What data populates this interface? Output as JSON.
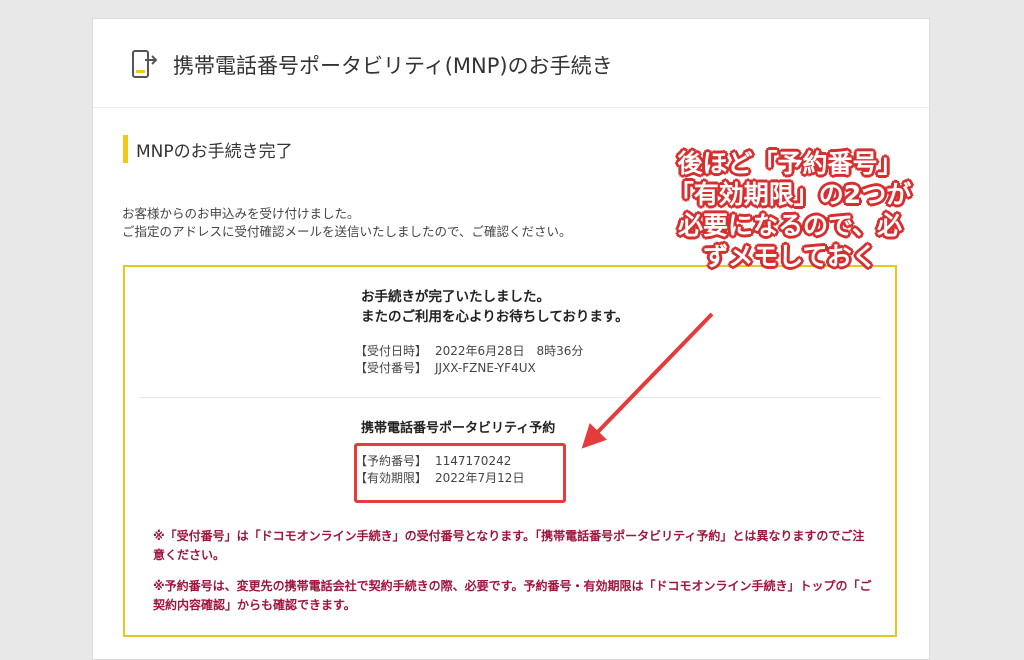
{
  "header": {
    "title": "携帯電話番号ポータビリティ(MNP)のお手続き",
    "icon": "phone-transfer-icon"
  },
  "section": {
    "title": "MNPのお手続き完了"
  },
  "intro": {
    "line1": "お客様からのお申込みを受け付けました。",
    "line2": "ご指定のアドレスに受付確認メールを送信いたしましたので、ご確認ください。"
  },
  "receipt": {
    "done_line1": "お手続きが完了いたしました。",
    "done_line2": "またのご利用を心よりお待ちしております。",
    "reception_date_label": "【受付日時】",
    "reception_date_value": "2022年6月28日　8時36分",
    "reception_number_label": "【受付番号】",
    "reception_number_value": "JJXX-FZNE-YF4UX"
  },
  "reservation": {
    "heading": "携帯電話番号ポータビリティ予約",
    "number_label": "【予約番号】",
    "number_value": "1147170242",
    "expiry_label": "【有効期限】",
    "expiry_value": "2022年7月12日"
  },
  "notes": {
    "note1": "※「受付番号」は「ドコモオンライン手続き」の受付番号となります。「携帯電話番号ポータビリティ予約」とは異なりますのでご注意ください。",
    "note2": "※予約番号は、変更先の携帯電話会社で契約手続きの際、必要です。予約番号・有効期限は「ドコモオンライン手続き」トップの「ご契約内容確認」からも確認できます。"
  },
  "annotation": {
    "line1": "後ほど「予約番号」",
    "line2": "「有効期限」の2つが",
    "line3": "必要になるので、必",
    "line4": "ずメモしておく"
  },
  "colors": {
    "accent_yellow": "#f3c81b",
    "box_border": "#e6c823",
    "highlight_red": "#e53b3b",
    "note_text": "#a0153e"
  }
}
